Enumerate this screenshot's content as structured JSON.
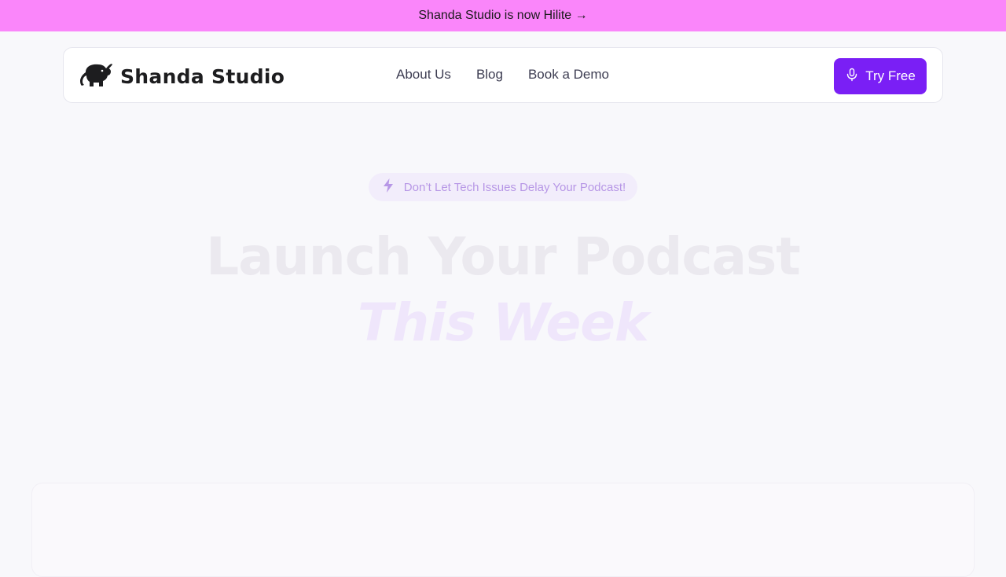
{
  "announcement": {
    "text": "Shanda Studio is now Hilite →"
  },
  "brand": {
    "name": "Shanda Studio",
    "logo_icon": "elephant-icon"
  },
  "nav": {
    "links": [
      {
        "label": "About Us"
      },
      {
        "label": "Blog"
      },
      {
        "label": "Book a Demo"
      }
    ]
  },
  "cta": {
    "label": "Try Free",
    "icon": "microphone-icon",
    "color": "#7a1ff5"
  },
  "hero": {
    "badge_icon": "lightning-bolt-icon",
    "badge_text": "Don’t Let Tech Issues Delay Your Podcast!",
    "headline_line1": "Launch Your Podcast",
    "headline_line2": "This Week"
  },
  "colors": {
    "announcement_bg": "#fa86fa",
    "page_bg": "#f8f8fb",
    "accent": "#7a1ff5"
  }
}
